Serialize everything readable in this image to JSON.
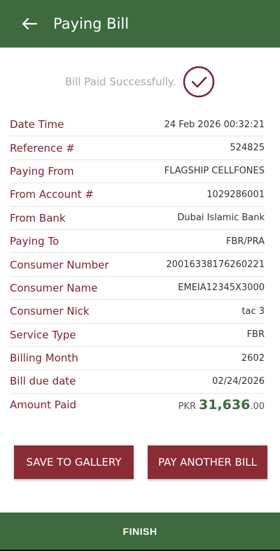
{
  "header": {
    "title": "Paying Bill",
    "back_icon": "arrow-left-icon"
  },
  "status": {
    "message": "Bill Paid Successfully.",
    "icon": "check-circle-icon",
    "color": "#7a2432"
  },
  "details": [
    {
      "label": "Date Time",
      "value": "24 Feb 2026 00:32:21"
    },
    {
      "label": "Reference #",
      "value": "524825"
    },
    {
      "label": "Paying From",
      "value": "FLAGSHIP CELLFONES"
    },
    {
      "label": "From Account #",
      "value": "1029286001"
    },
    {
      "label": "From Bank",
      "value": "Dubai Islamic Bank"
    },
    {
      "label": "Paying To",
      "value": "FBR/PRA"
    },
    {
      "label": "Consumer Number",
      "value": "20016338176260221"
    },
    {
      "label": "Consumer Name",
      "value": "EMEIA12345X3000"
    },
    {
      "label": "Consumer Nick",
      "value": "tac 3"
    },
    {
      "label": "Service Type",
      "value": "FBR"
    },
    {
      "label": "Billing Month",
      "value": "2602"
    },
    {
      "label": "Bill due date",
      "value": "02/24/2026"
    }
  ],
  "amount": {
    "label": "Amount Paid",
    "currency": "PKR",
    "whole": "31,636",
    "decimal": ".00"
  },
  "buttons": {
    "save_gallery": "SAVE TO GALLERY",
    "pay_another": "PAY ANOTHER BILL",
    "finish": "FINISH"
  },
  "colors": {
    "primary_green": "#3d6b3f",
    "maroon": "#8b2b33",
    "label_maroon": "#7a2432"
  }
}
